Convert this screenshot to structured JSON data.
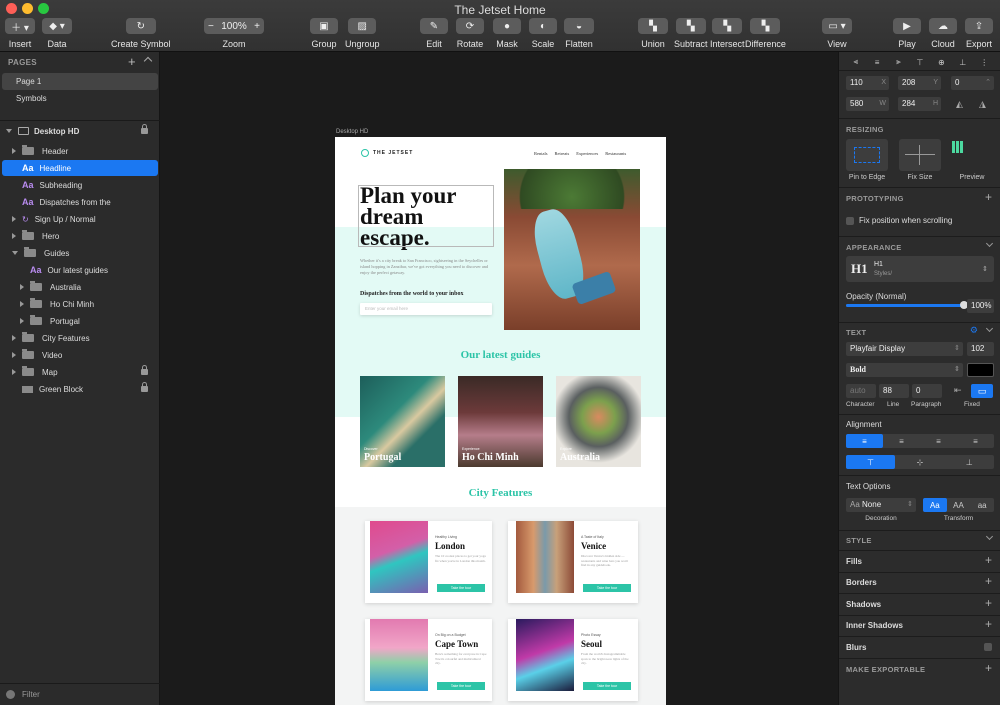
{
  "window": {
    "title": "The Jetset Home"
  },
  "toolbar": {
    "insert": "Insert",
    "data": "Data",
    "create_symbol": "Create Symbol",
    "zoom": "Zoom",
    "zoom_value": "100%",
    "group": "Group",
    "ungroup": "Ungroup",
    "edit": "Edit",
    "rotate": "Rotate",
    "mask": "Mask",
    "scale": "Scale",
    "flatten": "Flatten",
    "union": "Union",
    "subtract": "Subtract",
    "intersect": "Intersect",
    "difference": "Difference",
    "view": "View",
    "play": "Play",
    "cloud": "Cloud",
    "export": "Export"
  },
  "left": {
    "pages_header": "PAGES",
    "pages": [
      "Page 1",
      "Symbols"
    ],
    "artboard": "Desktop HD",
    "layers": [
      "Header",
      "Headline",
      "Subheading",
      "Dispatches from the",
      "Sign Up / Normal",
      "Hero",
      "Guides",
      "Our latest guides",
      "Australia",
      "Ho Chi Minh",
      "Portugal",
      "City Features",
      "Video",
      "Map",
      "Green Block"
    ],
    "filter": "Filter"
  },
  "canvas": {
    "artboard_label": "Desktop HD",
    "brand": "THE JETSET",
    "nav": [
      "Rentals",
      "Retreats",
      "Experiences",
      "Restaurants"
    ],
    "headline": "Plan your dream escape.",
    "subheading": "Whether it's a city break to San Francisco, sightseeing in the Seychelles or island hopping in Zanzibar, we've got everything you need to discover and enjoy the perfect getaway.",
    "dispatches": "Dispatches from the world to your inbox",
    "email_placeholder": "Enter your email here",
    "guides_title": "Our latest guides",
    "guides": [
      {
        "kicker": "Discover",
        "name": "Portugal"
      },
      {
        "kicker": "Experience",
        "name": "Ho Chi Minh"
      },
      {
        "kicker": "Explore",
        "name": "Australia"
      }
    ],
    "features_title": "City Features",
    "features": [
      {
        "kicker": "Healthy Living",
        "city": "London",
        "text": "The 10 coolest places to get your yoga fix when you're in London this month.",
        "cta": "Take the tour"
      },
      {
        "kicker": "A Taste of Italy",
        "city": "Venice",
        "text": "Discover Venice's hidden side — restaurants and wine bars you won't find in any guidebook.",
        "cta": "Take the tour"
      },
      {
        "kicker": "On Big on a Budget",
        "city": "Cape Town",
        "text": "Here's something for everyone in Cape Town's colourful and multicultural city.",
        "cta": "Take the tour"
      },
      {
        "kicker": "Photo Essay",
        "city": "Seoul",
        "text": "From the world's Instagrammable spots to the bright neon lights of the city.",
        "cta": "Take the tour"
      }
    ]
  },
  "right": {
    "x": "110",
    "y": "208",
    "rot": "0",
    "w": "580",
    "h": "284",
    "resizing": "RESIZING",
    "pin": "Pin to Edge",
    "fix_size": "Fix Size",
    "preview": "Preview",
    "prototyping": "PROTOTYPING",
    "fix_pos": "Fix position when scrolling",
    "appearance": "APPEARANCE",
    "style_name": "H1",
    "style_sub": "Styles/",
    "opacity_label": "Opacity (Normal)",
    "opacity": "100%",
    "opacity_value": 1.0,
    "text": "TEXT",
    "font": "Playfair Display",
    "font_size": "102",
    "weight": "Bold",
    "char": "auto",
    "line": "88",
    "para": "0",
    "character": "Character",
    "line_lbl": "Line",
    "paragraph": "Paragraph",
    "fixed": "Fixed",
    "alignment": "Alignment",
    "text_options": "Text Options",
    "decoration_value": "None",
    "decoration": "Decoration",
    "transform": "Transform",
    "transforms": [
      "Aa",
      "AA",
      "aa"
    ],
    "style": "STYLE",
    "fills": "Fills",
    "borders": "Borders",
    "shadows": "Shadows",
    "inner_shadows": "Inner Shadows",
    "blurs": "Blurs",
    "exportable": "MAKE EXPORTABLE"
  },
  "colors": {
    "accent": "#1b78f2",
    "teal": "#2cc4a7",
    "mint": "#e3faf5",
    "tag_green": "#4cd9a0"
  }
}
